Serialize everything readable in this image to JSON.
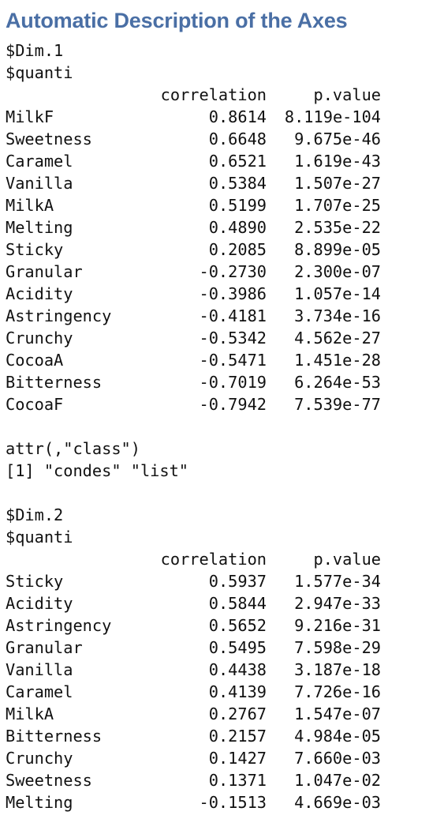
{
  "title": "Automatic Description of the Axes",
  "dim1": {
    "label": "$Dim.1",
    "sub": "$quanti",
    "header": {
      "correlation": "correlation",
      "pvalue": "p.value"
    },
    "rows": [
      {
        "name": "MilkF",
        "corr": "0.8614",
        "p": "8.119e-104"
      },
      {
        "name": "Sweetness",
        "corr": "0.6648",
        "p": "9.675e-46"
      },
      {
        "name": "Caramel",
        "corr": "0.6521",
        "p": "1.619e-43"
      },
      {
        "name": "Vanilla",
        "corr": "0.5384",
        "p": "1.507e-27"
      },
      {
        "name": "MilkA",
        "corr": "0.5199",
        "p": "1.707e-25"
      },
      {
        "name": "Melting",
        "corr": "0.4890",
        "p": "2.535e-22"
      },
      {
        "name": "Sticky",
        "corr": "0.2085",
        "p": "8.899e-05"
      },
      {
        "name": "Granular",
        "corr": "-0.2730",
        "p": "2.300e-07"
      },
      {
        "name": "Acidity",
        "corr": "-0.3986",
        "p": "1.057e-14"
      },
      {
        "name": "Astringency",
        "corr": "-0.4181",
        "p": "3.734e-16"
      },
      {
        "name": "Crunchy",
        "corr": "-0.5342",
        "p": "4.562e-27"
      },
      {
        "name": "CocoaA",
        "corr": "-0.5471",
        "p": "1.451e-28"
      },
      {
        "name": "Bitterness",
        "corr": "-0.7019",
        "p": "6.264e-53"
      },
      {
        "name": "CocoaF",
        "corr": "-0.7942",
        "p": "7.539e-77"
      }
    ]
  },
  "attr": {
    "line1": "attr(,\"class\")",
    "line2": "[1] \"condes\" \"list\""
  },
  "dim2": {
    "label": "$Dim.2",
    "sub": "$quanti",
    "header": {
      "correlation": "correlation",
      "pvalue": "p.value"
    },
    "rows": [
      {
        "name": "Sticky",
        "corr": "0.5937",
        "p": "1.577e-34"
      },
      {
        "name": "Acidity",
        "corr": "0.5844",
        "p": "2.947e-33"
      },
      {
        "name": "Astringency",
        "corr": "0.5652",
        "p": "9.216e-31"
      },
      {
        "name": "Granular",
        "corr": "0.5495",
        "p": "7.598e-29"
      },
      {
        "name": "Vanilla",
        "corr": "0.4438",
        "p": "3.187e-18"
      },
      {
        "name": "Caramel",
        "corr": "0.4139",
        "p": "7.726e-16"
      },
      {
        "name": "MilkA",
        "corr": "0.2767",
        "p": "1.547e-07"
      },
      {
        "name": "Bitterness",
        "corr": "0.2157",
        "p": "4.984e-05"
      },
      {
        "name": "Crunchy",
        "corr": "0.1427",
        "p": "7.660e-03"
      },
      {
        "name": "Sweetness",
        "corr": "0.1371",
        "p": "1.047e-02"
      },
      {
        "name": "Melting",
        "corr": "-0.1513",
        "p": "4.669e-03"
      }
    ]
  }
}
